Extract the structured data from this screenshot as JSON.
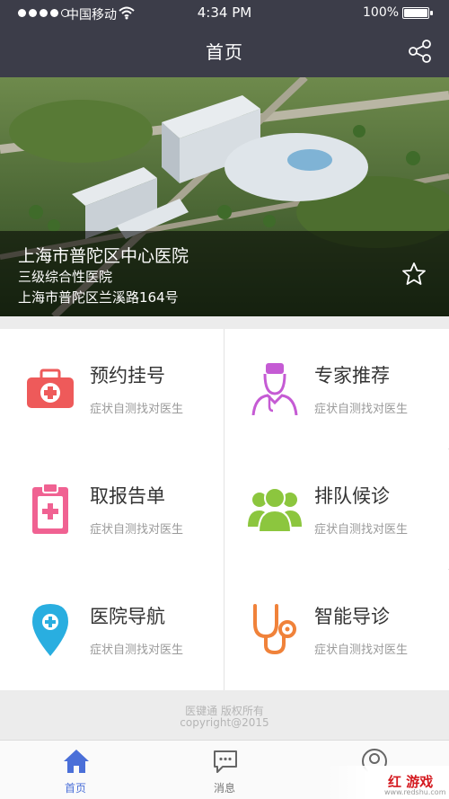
{
  "status_bar": {
    "carrier": "中国移动",
    "time": "4:34 PM",
    "battery": "100%",
    "battery_level": 1.0
  },
  "nav": {
    "title": "首页",
    "share_icon": "share-icon"
  },
  "banner": {
    "hospital_name": "上海市普陀区中心医院",
    "hospital_level": "三级综合性医院",
    "address": "上海市普陀区兰溪路164号",
    "favorite_icon": "star-outline-icon"
  },
  "services": [
    {
      "title": "预约挂号",
      "subtitle": "症状自测找对医生",
      "icon": "medical-kit-icon",
      "color": "#ee5a5a"
    },
    {
      "title": "专家推荐",
      "subtitle": "症状自测找对医生",
      "icon": "doctor-icon",
      "color": "#c55bd4"
    },
    {
      "title": "取报告单",
      "subtitle": "症状自测找对医生",
      "icon": "report-clipboard-icon",
      "color": "#f06292"
    },
    {
      "title": "排队候诊",
      "subtitle": "症状自测找对医生",
      "icon": "queue-people-icon",
      "color": "#8cc63e"
    },
    {
      "title": "医院导航",
      "subtitle": "症状自测找对医生",
      "icon": "map-pin-icon",
      "color": "#29aee0"
    },
    {
      "title": "智能导诊",
      "subtitle": "症状自测找对医生",
      "icon": "stethoscope-icon",
      "color": "#f0823a"
    }
  ],
  "footer": {
    "line1": "医键通 版权所有",
    "line2": "copyright@2015"
  },
  "tabs": [
    {
      "label": "首页",
      "icon": "home-icon",
      "active": true
    },
    {
      "label": "消息",
      "icon": "message-icon",
      "active": false
    },
    {
      "label": "",
      "icon": "profile-icon",
      "active": false
    }
  ],
  "watermark": {
    "text": "红  游戏",
    "url": "www.redshu.com"
  },
  "colors": {
    "header": "#3c3d49",
    "accent": "#4a6fd8"
  }
}
